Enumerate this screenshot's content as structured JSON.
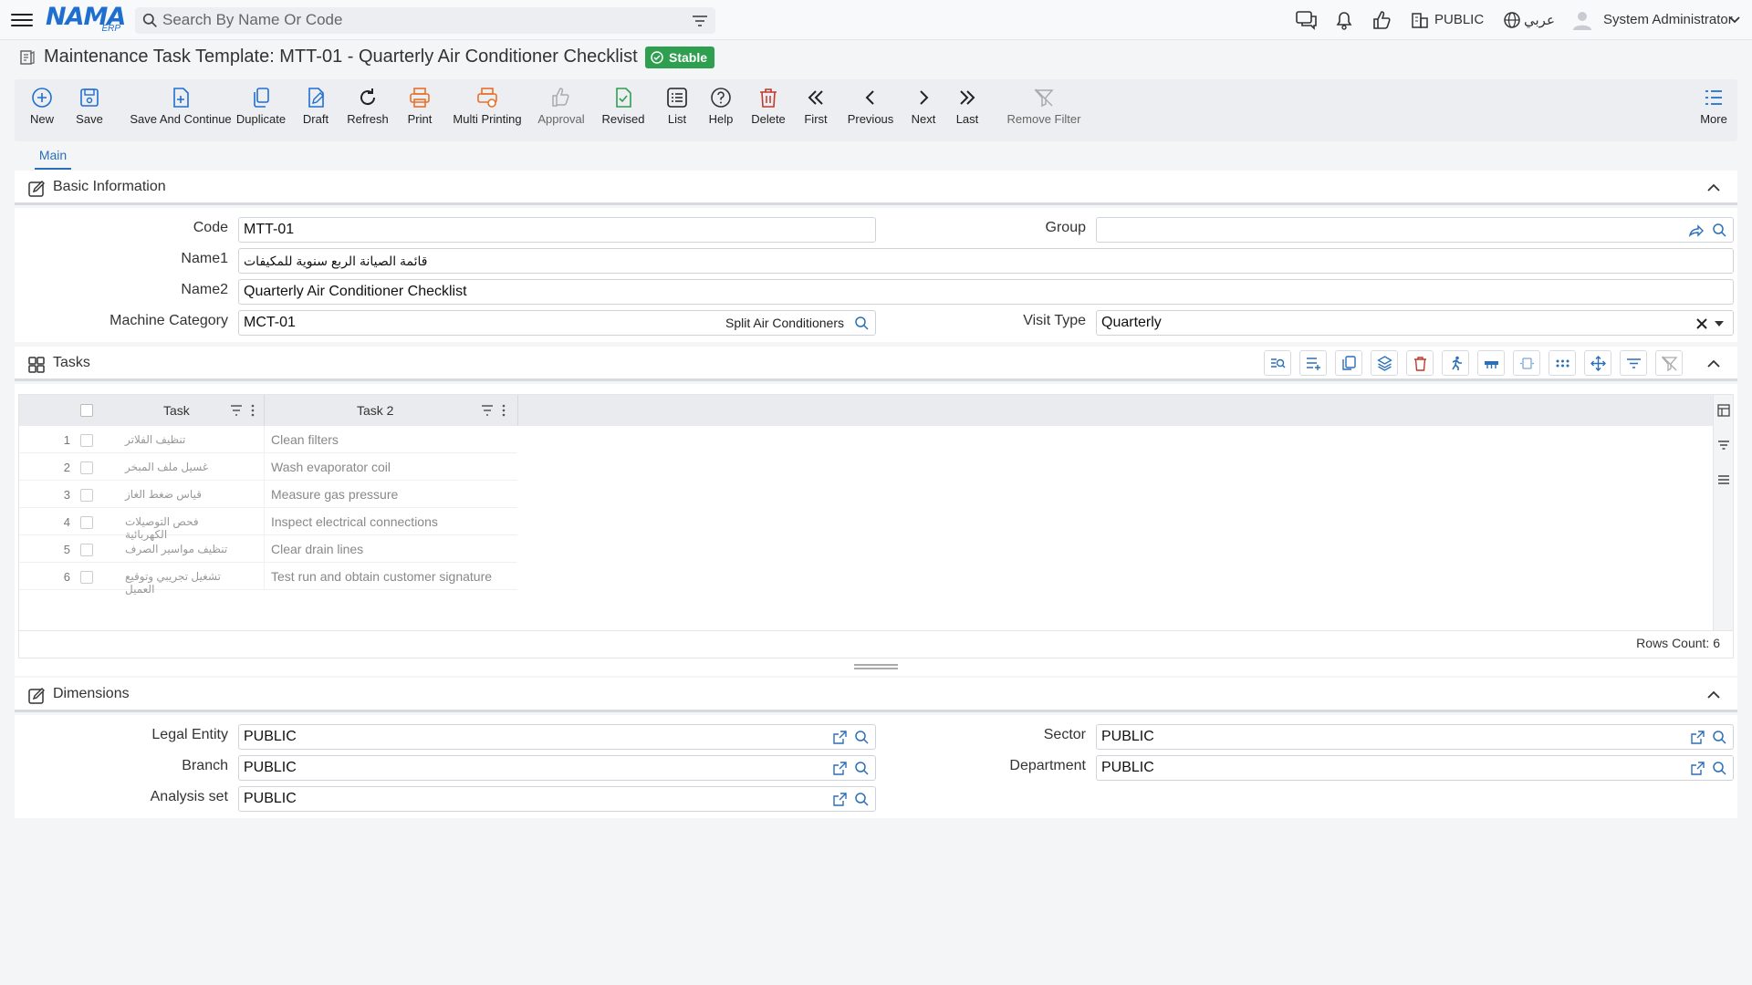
{
  "topbar": {
    "logo_text": "NAMA",
    "logo_sub": "ERP",
    "search_placeholder": "Search By Name Or Code",
    "company": "PUBLIC",
    "language": "عربي",
    "user": "System Administrator"
  },
  "page": {
    "title": "Maintenance Task Template: MTT-01 - Quarterly Air Conditioner Checklist",
    "status": "Stable"
  },
  "toolbar": {
    "items": [
      {
        "label": "New",
        "icon": "plus-circle-icon"
      },
      {
        "label": "Save",
        "icon": "save-icon"
      },
      {
        "label": "Save And Continue",
        "icon": "save-continue-icon"
      },
      {
        "label": "Duplicate",
        "icon": "duplicate-icon"
      },
      {
        "label": "Draft",
        "icon": "draft-icon"
      },
      {
        "label": "Refresh",
        "icon": "refresh-icon"
      },
      {
        "label": "Print",
        "icon": "print-icon"
      },
      {
        "label": "Multi Printing",
        "icon": "multi-print-icon"
      },
      {
        "label": "Approval",
        "icon": "thumbs-up-icon"
      },
      {
        "label": "Revised",
        "icon": "revised-icon"
      },
      {
        "label": "List",
        "icon": "list-icon"
      },
      {
        "label": "Help",
        "icon": "help-icon"
      },
      {
        "label": "Delete",
        "icon": "trash-icon"
      },
      {
        "label": "First",
        "icon": "double-chevron-left-icon"
      },
      {
        "label": "Previous",
        "icon": "chevron-left-icon"
      },
      {
        "label": "Next",
        "icon": "chevron-right-icon"
      },
      {
        "label": "Last",
        "icon": "double-chevron-right-icon"
      },
      {
        "label": "Remove Filter",
        "icon": "remove-filter-icon"
      },
      {
        "label": "More",
        "icon": "more-list-icon"
      }
    ]
  },
  "tabs": [
    {
      "label": "Main"
    }
  ],
  "basic": {
    "title": "Basic Information",
    "code_label": "Code",
    "code_value": "MTT-01",
    "group_label": "Group",
    "group_value": "",
    "name1_label": "Name1",
    "name1_value": "قائمة الصيانة الربع سنوية للمكيفات",
    "name2_label": "Name2",
    "name2_value": "Quarterly Air Conditioner Checklist",
    "machine_label": "Machine Category",
    "machine_value": "MCT-01",
    "machine_desc": "Split Air Conditioners",
    "visit_label": "Visit Type",
    "visit_value": "Quarterly"
  },
  "tasks": {
    "title": "Tasks",
    "columns": [
      "Task",
      "Task 2"
    ],
    "rows": [
      {
        "n": "1",
        "task": "تنظيف الفلاتر",
        "task2": "Clean filters"
      },
      {
        "n": "2",
        "task": "غسيل ملف المبخر",
        "task2": "Wash evaporator coil"
      },
      {
        "n": "3",
        "task": "قياس ضغط الغاز",
        "task2": "Measure gas pressure"
      },
      {
        "n": "4",
        "task": "فحص التوصيلات الكهربائية",
        "task2": "Inspect electrical connections"
      },
      {
        "n": "5",
        "task": "تنظيف مواسير الصرف",
        "task2": "Clear drain lines"
      },
      {
        "n": "6",
        "task": "تشغيل تجريبي وتوقيع العميل",
        "task2": "Test run and obtain customer signature"
      }
    ],
    "rows_count": "Rows Count: 6"
  },
  "dimensions": {
    "title": "Dimensions",
    "legal_label": "Legal Entity",
    "legal_value": "PUBLIC",
    "sector_label": "Sector",
    "sector_value": "PUBLIC",
    "branch_label": "Branch",
    "branch_value": "PUBLIC",
    "department_label": "Department",
    "department_value": "PUBLIC",
    "analysis_label": "Analysis set",
    "analysis_value": "PUBLIC"
  },
  "colors": {
    "accent": "#1f6fd1",
    "status": "#2e9e4f",
    "print": "#e8702a",
    "delete": "#c0392b",
    "revised": "#2e9e4f"
  }
}
